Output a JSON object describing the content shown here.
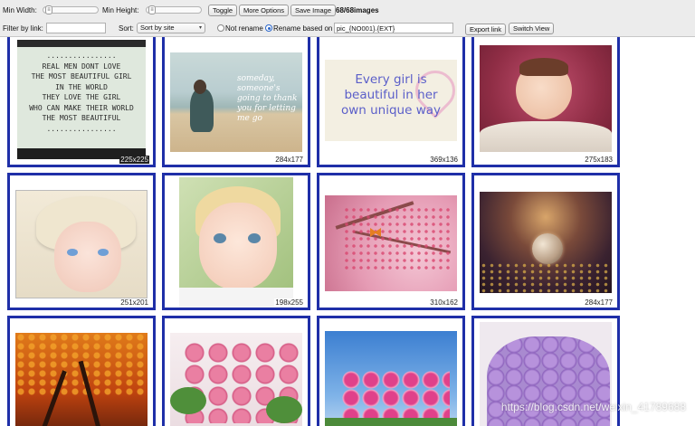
{
  "toolbar": {
    "min_width_label": "Min Width:",
    "min_height_label": "Min Height:",
    "toggle_label": "Toggle",
    "more_options_label": "More Options",
    "save_image_label": "Save Image",
    "image_count": "68/68images",
    "filter_label": "Filter by link:",
    "filter_value": "",
    "sort_label": "Sort:",
    "sort_value": "Sort by site",
    "not_rename_label": "Not rename",
    "rename_label": "Rename based on",
    "rename_pattern": "pic_{NO001}.{EXT}",
    "export_label": "Export link",
    "switch_view_label": "Switch View"
  },
  "images": [
    {
      "dims": "225x225",
      "lines": [
        "................",
        "REAL MEN DONT LOVE",
        "THE MOST BEAUTIFUL GIRL",
        "IN THE WORLD",
        "THEY LOVE THE GIRL",
        "WHO CAN MAKE THEIR WORLD",
        "THE MOST BEAUTIFUL",
        "................"
      ]
    },
    {
      "dims": "284x177",
      "overlay": "someday, someone's going to thank you for letting me go"
    },
    {
      "dims": "369x136",
      "lines": [
        "Every girl is",
        "beautiful in her",
        "own unique way"
      ]
    },
    {
      "dims": "275x183"
    },
    {
      "dims": "251x201"
    },
    {
      "dims": "198x255"
    },
    {
      "dims": "310x162"
    },
    {
      "dims": "284x177"
    },
    {
      "dims": ""
    },
    {
      "dims": ""
    },
    {
      "dims": ""
    },
    {
      "dims": ""
    }
  ],
  "watermark": "https://blog.csdn.net/weixin_41789688",
  "colors": {
    "card_border": "#1f2fa8",
    "toolbar_bg": "#ececec"
  }
}
